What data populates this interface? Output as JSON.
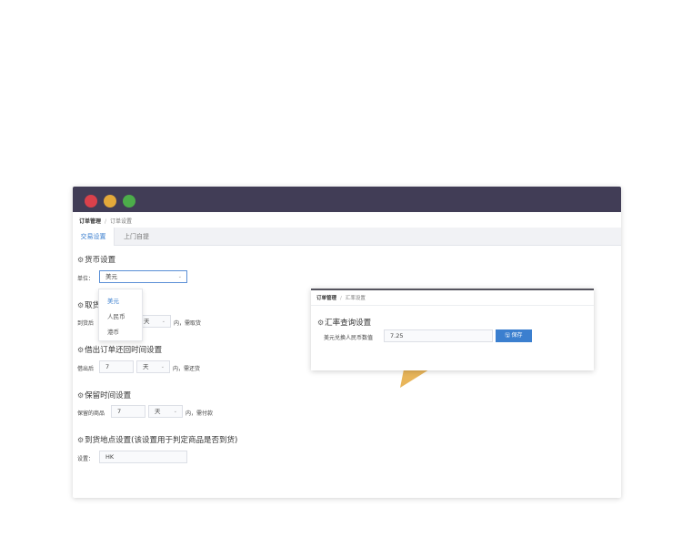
{
  "breadcrumb": {
    "parent": "订单管理",
    "current": "订单设置"
  },
  "tabs": [
    {
      "label": "交易设置"
    },
    {
      "label": "上门自提"
    }
  ],
  "currency": {
    "title": "货币设置",
    "unit_label": "单位：",
    "selected": "美元",
    "options": [
      "美元",
      "人民币",
      "港币"
    ]
  },
  "pickup": {
    "title_visible": "取货",
    "prefix": "到货后",
    "unit": "天",
    "suffix": "内，需取货"
  },
  "return": {
    "title": "借出订单还回时间设置",
    "prefix": "借出后",
    "value": "7",
    "unit": "天",
    "suffix": "内，需还货"
  },
  "retain": {
    "title": "保留时间设置",
    "prefix": "保留的商品",
    "value": "7",
    "unit": "天",
    "suffix": "内，需付款"
  },
  "location": {
    "title": "到货地点设置(该设置用于判定商品是否到货)",
    "label": "设置：",
    "value": "HK"
  },
  "popup": {
    "breadcrumb_parent": "订单管理",
    "breadcrumb_current": "汇率设置",
    "title": "汇率查询设置",
    "label": "美元兑换人民币数值",
    "value": "7.25",
    "save_icon": "save-icon",
    "save_label": "保存"
  },
  "colors": {
    "titlebar": "#413d56",
    "accent": "#3b7fcf",
    "dot_red": "#d9414b",
    "dot_yellow": "#e3a93a",
    "dot_green": "#4cad4a",
    "pointer": "#e8b55a"
  },
  "icons": {
    "section": "settings-gear-icon",
    "dropdown": "chevron-down-icon"
  }
}
